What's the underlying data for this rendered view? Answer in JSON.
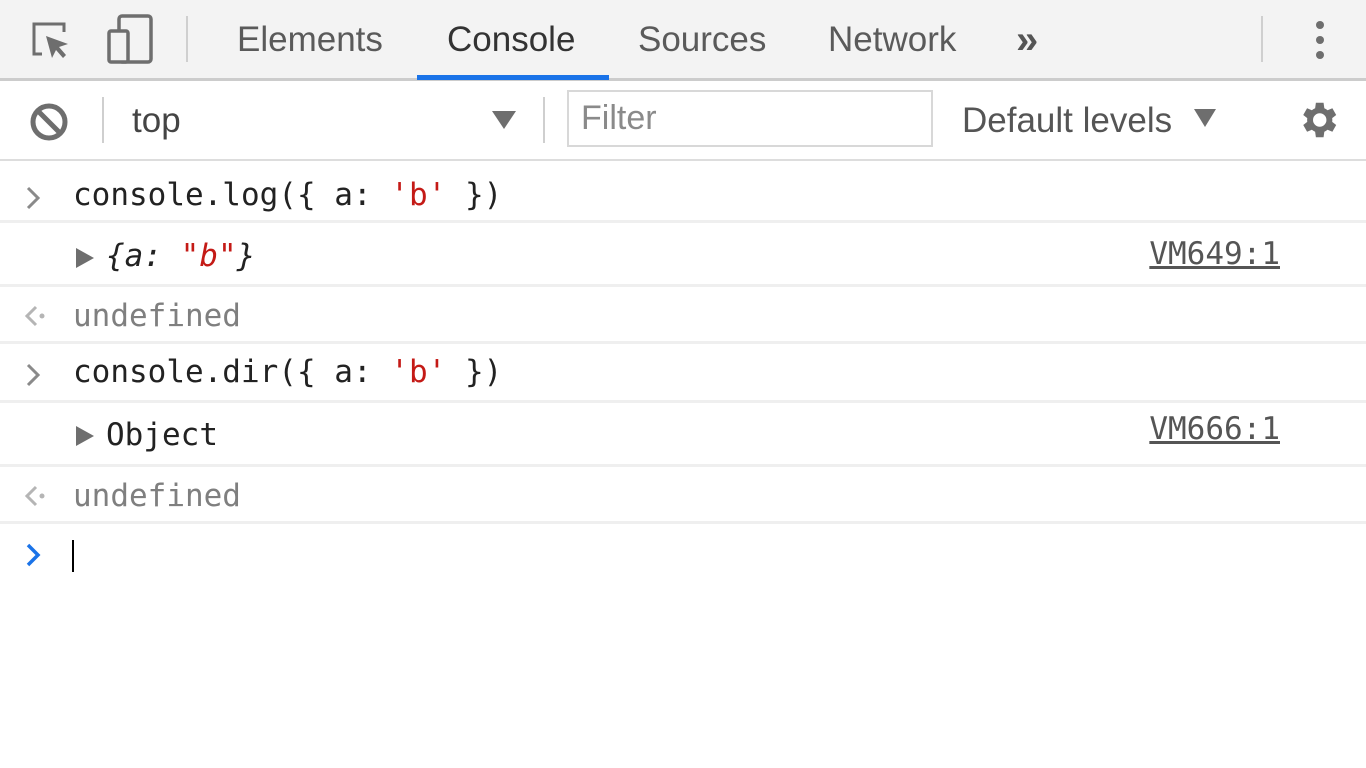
{
  "tabbar": {
    "inspect_icon": "inspect-element-icon",
    "device_icon": "device-toolbar-icon",
    "tabs": [
      {
        "label": "Elements",
        "active": false
      },
      {
        "label": "Console",
        "active": true
      },
      {
        "label": "Sources",
        "active": false
      },
      {
        "label": "Network",
        "active": false
      }
    ],
    "overflow_label": "»",
    "menu_icon": "vertical-dots-icon",
    "accent_color": "#1a73e8"
  },
  "toolbar": {
    "clear_icon": "clear-console-icon",
    "context": "top",
    "filter_placeholder": "Filter",
    "filter_value": "",
    "levels": "Default levels",
    "settings_icon": "gear-icon"
  },
  "console": {
    "entries": [
      {
        "type": "input",
        "code_prefix": "console.log({ a: ",
        "code_string": "'b'",
        "code_suffix": " })"
      },
      {
        "type": "log",
        "obj_open": "{a: ",
        "obj_value": "\"b\"",
        "obj_close": "}",
        "source": "VM649:1"
      },
      {
        "type": "result",
        "value": "undefined"
      },
      {
        "type": "input",
        "code_prefix": "console.dir({ a: ",
        "code_string": "'b'",
        "code_suffix": " })"
      },
      {
        "type": "log",
        "label": "Object",
        "source": "VM666:1"
      },
      {
        "type": "result",
        "value": "undefined"
      }
    ],
    "prompt_value": ""
  }
}
